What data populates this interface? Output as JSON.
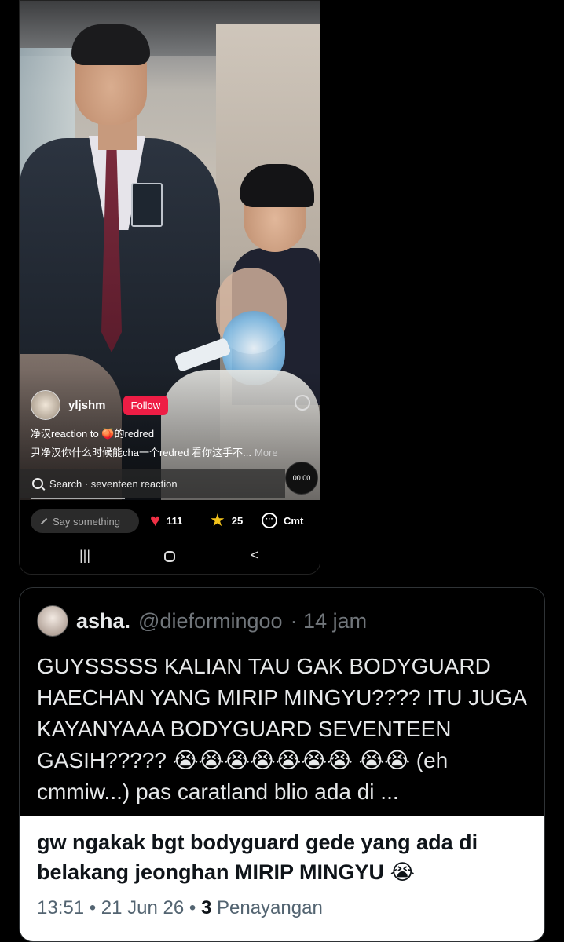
{
  "video_post": {
    "username": "yljshm",
    "follow_label": "Follow",
    "caption_line1": "净汉reaction to 🍑的redred",
    "caption_line2": "尹净汉你什么时候能cha一个redred 看你这手不...",
    "more_label": "More",
    "search_text": "Search · seventeen reaction",
    "timer": "00.00",
    "say_placeholder": "Say something",
    "likes": "111",
    "favorites": "25",
    "comment_label": "Cmt"
  },
  "nav": {
    "recents": "|||",
    "back": "<"
  },
  "quoted_tweet": {
    "name": "asha.",
    "handle": "@dieformingoo",
    "time": "· 14 jam",
    "text": "GUYSSSSS KALIAN TAU GAK BODYGUARD HAECHAN YANG MIRIP MINGYU???? ITU JUGA KAYANYAAA BODYGUARD SEVENTEEN GASIH????? 😭😭😭😭😭😭😭 😭😭 (eh cmmiw...) pas caratland blio ada di ..."
  },
  "main_tweet": {
    "text": "gw ngakak bgt bodyguard gede yang ada di belakang jeonghan MIRIP MINGYU 😭",
    "time": "13:51 • 21 Jun 26 •",
    "views_count": "3",
    "views_label": "Penayangan"
  },
  "colors": {
    "follow": "#ee1d45",
    "like": "#f03045",
    "star": "#f2c21b",
    "card_border": "#2f3336"
  }
}
